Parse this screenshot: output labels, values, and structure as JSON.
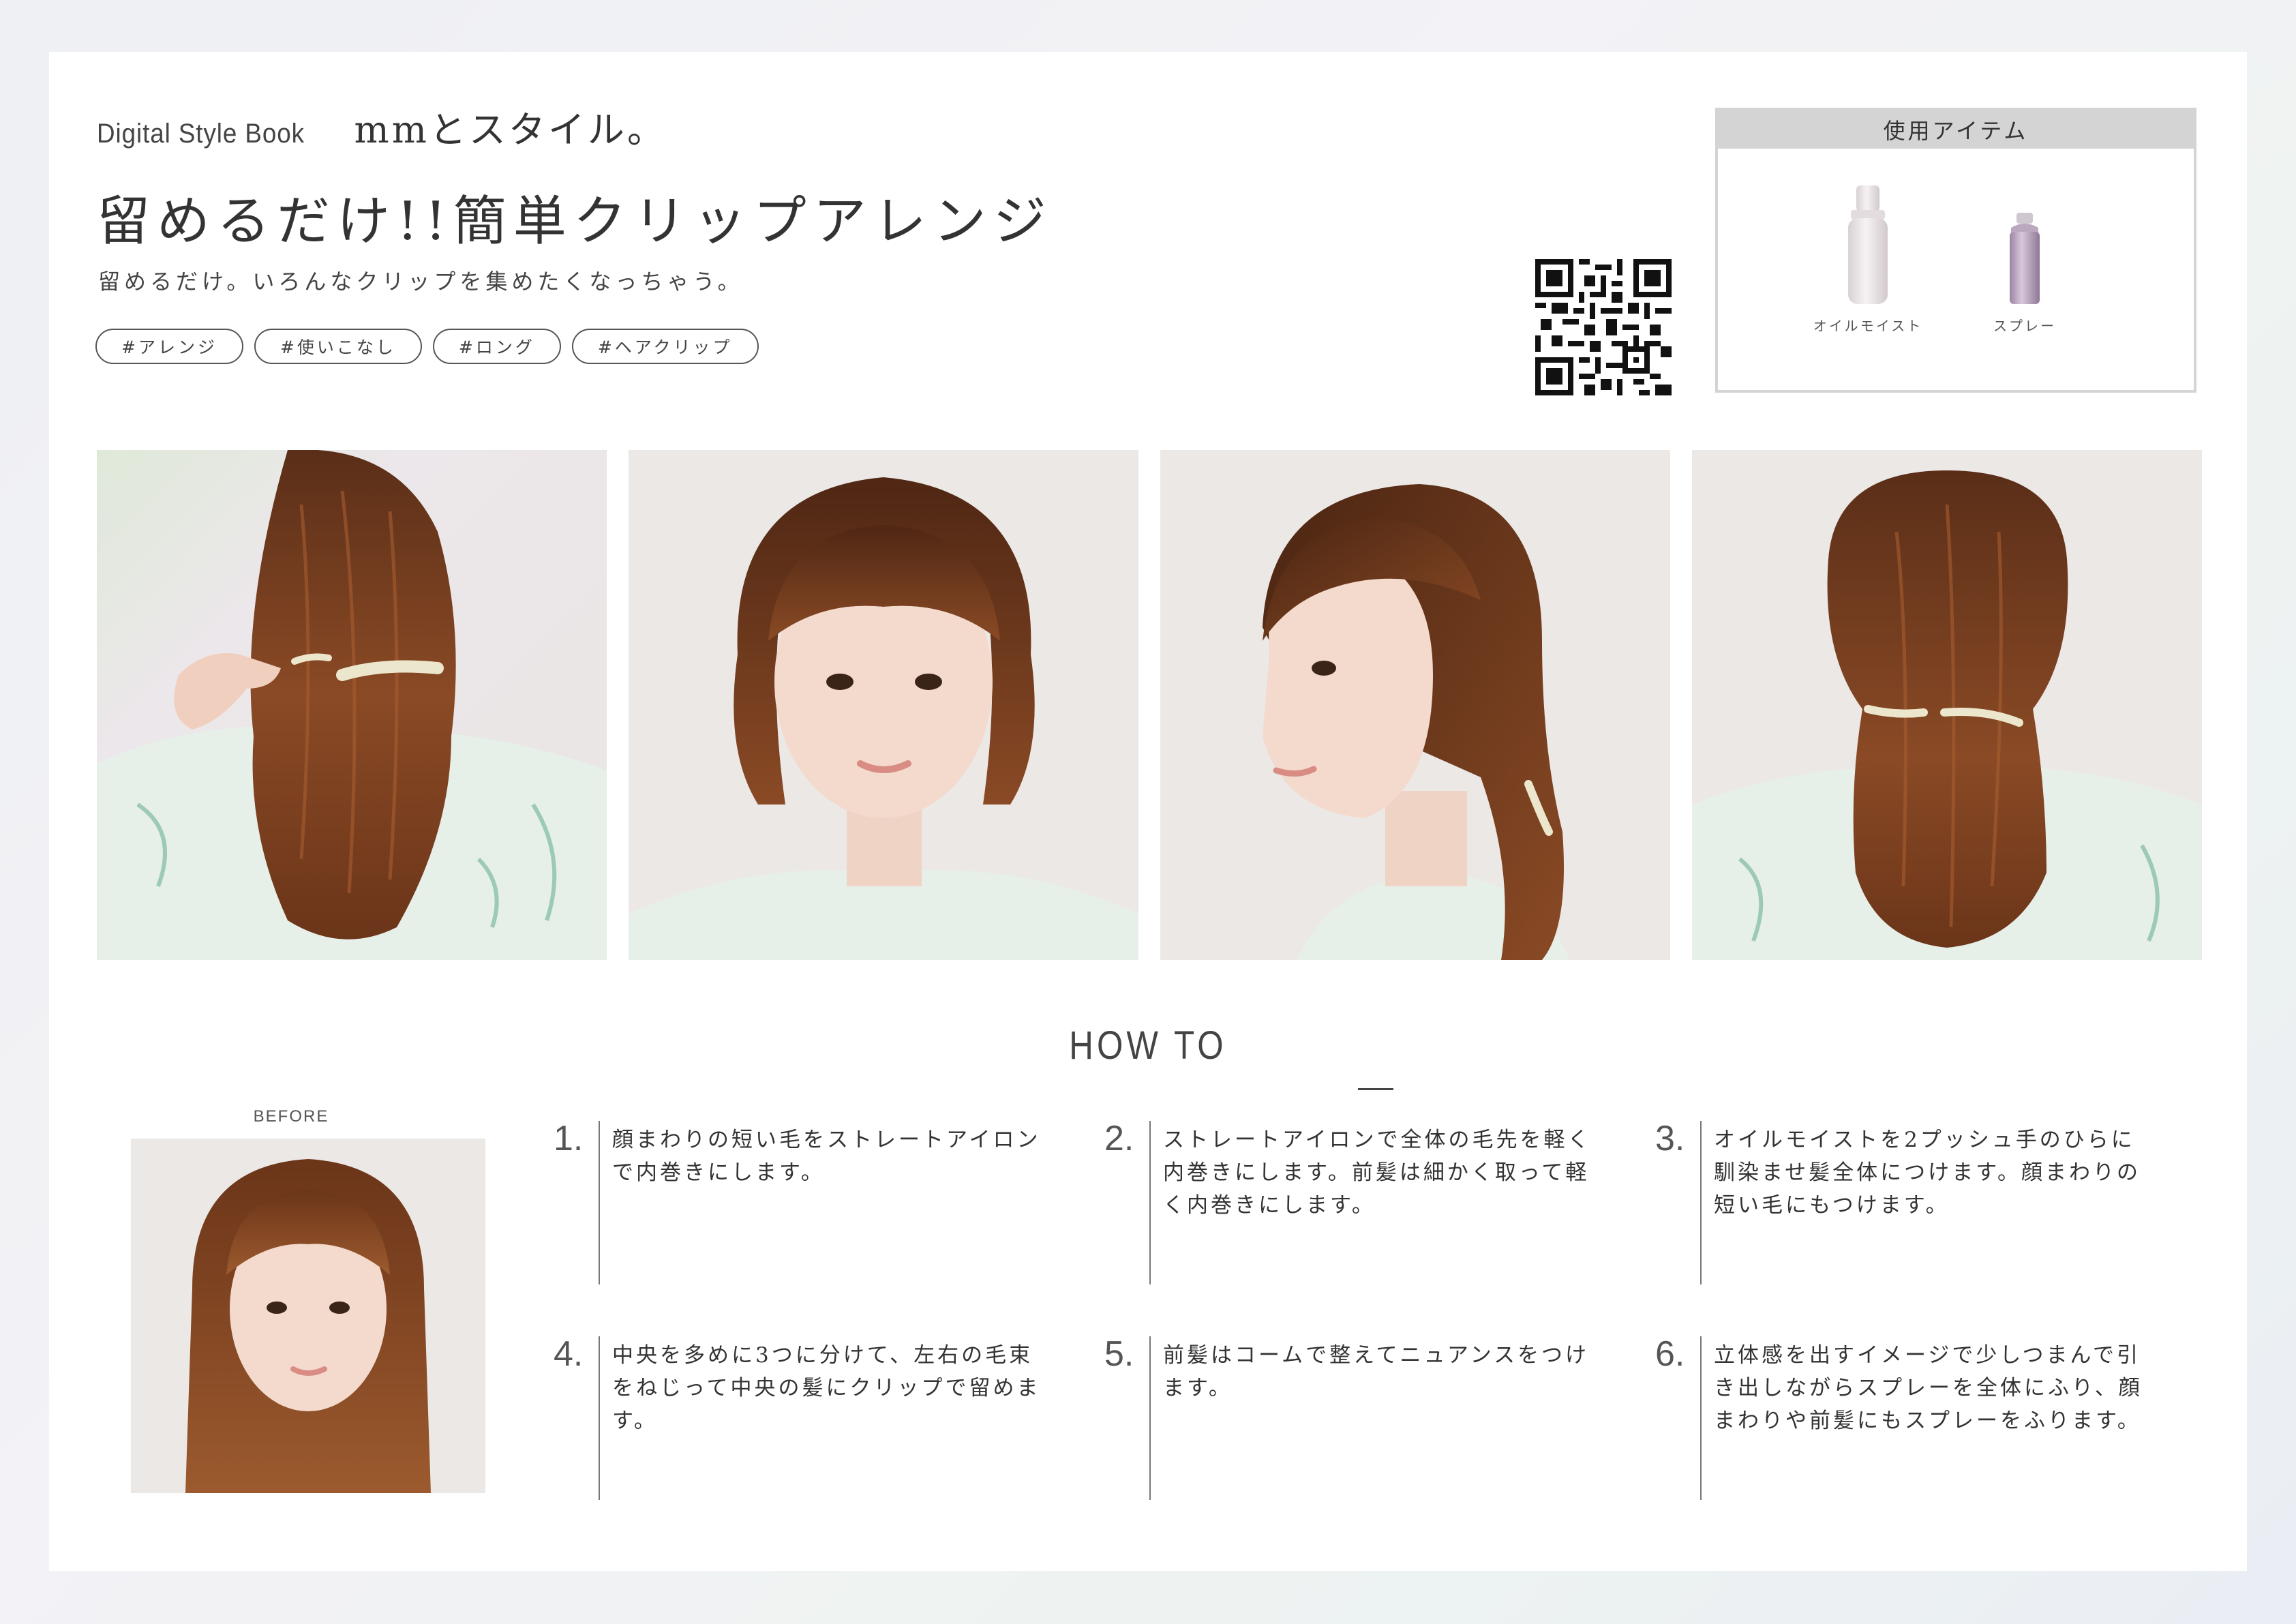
{
  "header": {
    "brand_en": "Digital Style Book",
    "brand_jp": "mmとスタイル。",
    "title": "留めるだけ!!簡単クリップアレンジ",
    "subtitle": "留めるだけ。いろんなクリップを集めたくなっちゃう。",
    "tags": [
      "#アレンジ",
      "#使いこなし",
      "#ロング",
      "#ヘアクリップ"
    ]
  },
  "qr": {
    "icon": "qr-code-icon"
  },
  "items": {
    "heading": "使用アイテム",
    "products": [
      {
        "label": "オイルモイスト",
        "icon": "oil-bottle-icon",
        "color": "#e9e3e5"
      },
      {
        "label": "スプレー",
        "icon": "spray-can-icon",
        "color": "#b9a3bf"
      }
    ]
  },
  "photos": [
    {
      "view": "back-clipping",
      "icon": "photo-back-clip-icon"
    },
    {
      "view": "front",
      "icon": "photo-front-icon"
    },
    {
      "view": "side",
      "icon": "photo-side-icon"
    },
    {
      "view": "back",
      "icon": "photo-back-icon"
    }
  ],
  "howto": {
    "heading": "HOW TO",
    "before_label": "BEFORE",
    "steps": [
      {
        "num": "1.",
        "text": "顔まわりの短い毛をストレートアイロンで内巻きにします。"
      },
      {
        "num": "2.",
        "text": "ストレートアイロンで全体の毛先を軽く内巻きにします。前髪は細かく取って軽く内巻きにします。"
      },
      {
        "num": "3.",
        "text": "オイルモイストを2プッシュ手のひらに馴染ませ髪全体につけます。顔まわりの短い毛にもつけます。"
      },
      {
        "num": "4.",
        "text": "中央を多めに3つに分けて、左右の毛束をねじって中央の髪にクリップで留めます。"
      },
      {
        "num": "5.",
        "text": "前髪はコームで整えてニュアンスをつけます。"
      },
      {
        "num": "6.",
        "text": "立体感を出すイメージで少しつまんで引き出しながらスプレーを全体にふり、顔まわりや前髪にもスプレーをふります。"
      }
    ]
  },
  "colors": {
    "hair": "#8a4a25",
    "blouse": "#e7efe9",
    "skin": "#f2d9cb",
    "backdrop": "#ece8e6",
    "clip": "#e8e2c8"
  }
}
